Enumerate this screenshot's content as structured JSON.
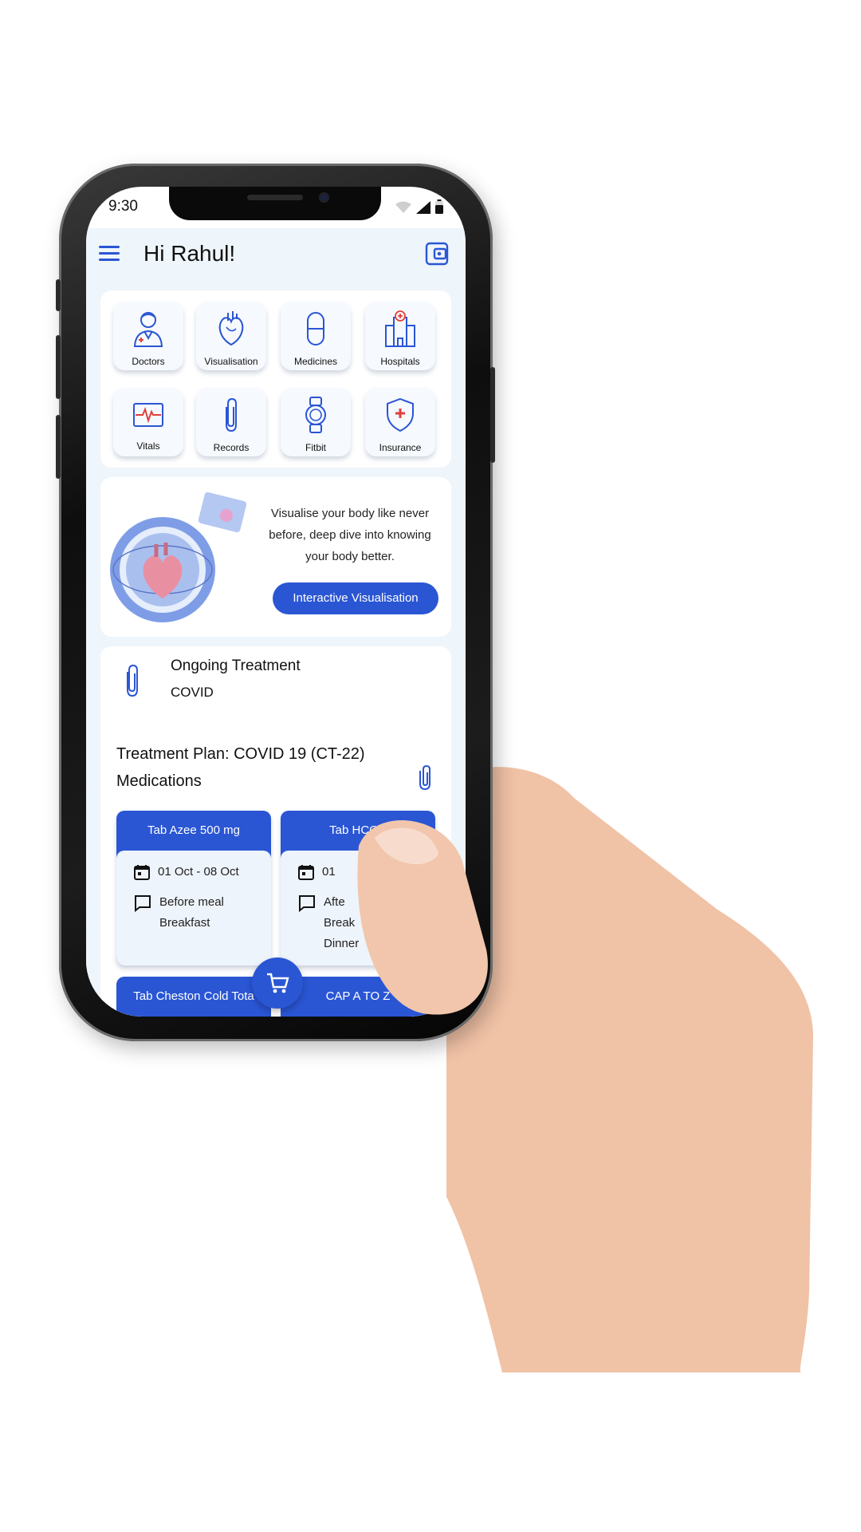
{
  "status_bar": {
    "time": "9:30"
  },
  "header": {
    "greeting": "Hi Rahul!"
  },
  "quick_actions": [
    {
      "label": "Doctors",
      "icon": "doctor-icon"
    },
    {
      "label": "Visualisation",
      "icon": "heart-icon"
    },
    {
      "label": "Medicines",
      "icon": "capsule-icon"
    },
    {
      "label": "Hospitals",
      "icon": "hospital-icon"
    },
    {
      "label": "Vitals",
      "icon": "ecg-icon"
    },
    {
      "label": "Records",
      "icon": "paperclip-icon"
    },
    {
      "label": "Fitbit",
      "icon": "watch-icon"
    },
    {
      "label": "Insurance",
      "icon": "shield-cross-icon"
    }
  ],
  "promo": {
    "text": "Visualise your body like never before, deep dive into knowing your body better.",
    "button_label": "Interactive Visualisation"
  },
  "treatment": {
    "title": "Ongoing Treatment",
    "condition": "COVID",
    "plan_label": "Treatment Plan: COVID 19 (CT-22)",
    "medications_heading": "Medications",
    "medications": [
      {
        "name": "Tab Azee 500 mg",
        "dates": "01 Oct - 08 Oct",
        "timing": [
          "Before meal",
          "Breakfast"
        ]
      },
      {
        "name": "Tab HCQS",
        "dates": "01",
        "timing": [
          "Afte",
          "Break",
          "Dinner"
        ]
      },
      {
        "name": "Tab Cheston Cold Tota"
      },
      {
        "name": "CAP A TO Z"
      }
    ]
  },
  "colors": {
    "primary": "#2a56d4",
    "background": "#eef5fb",
    "card": "#ffffff"
  }
}
